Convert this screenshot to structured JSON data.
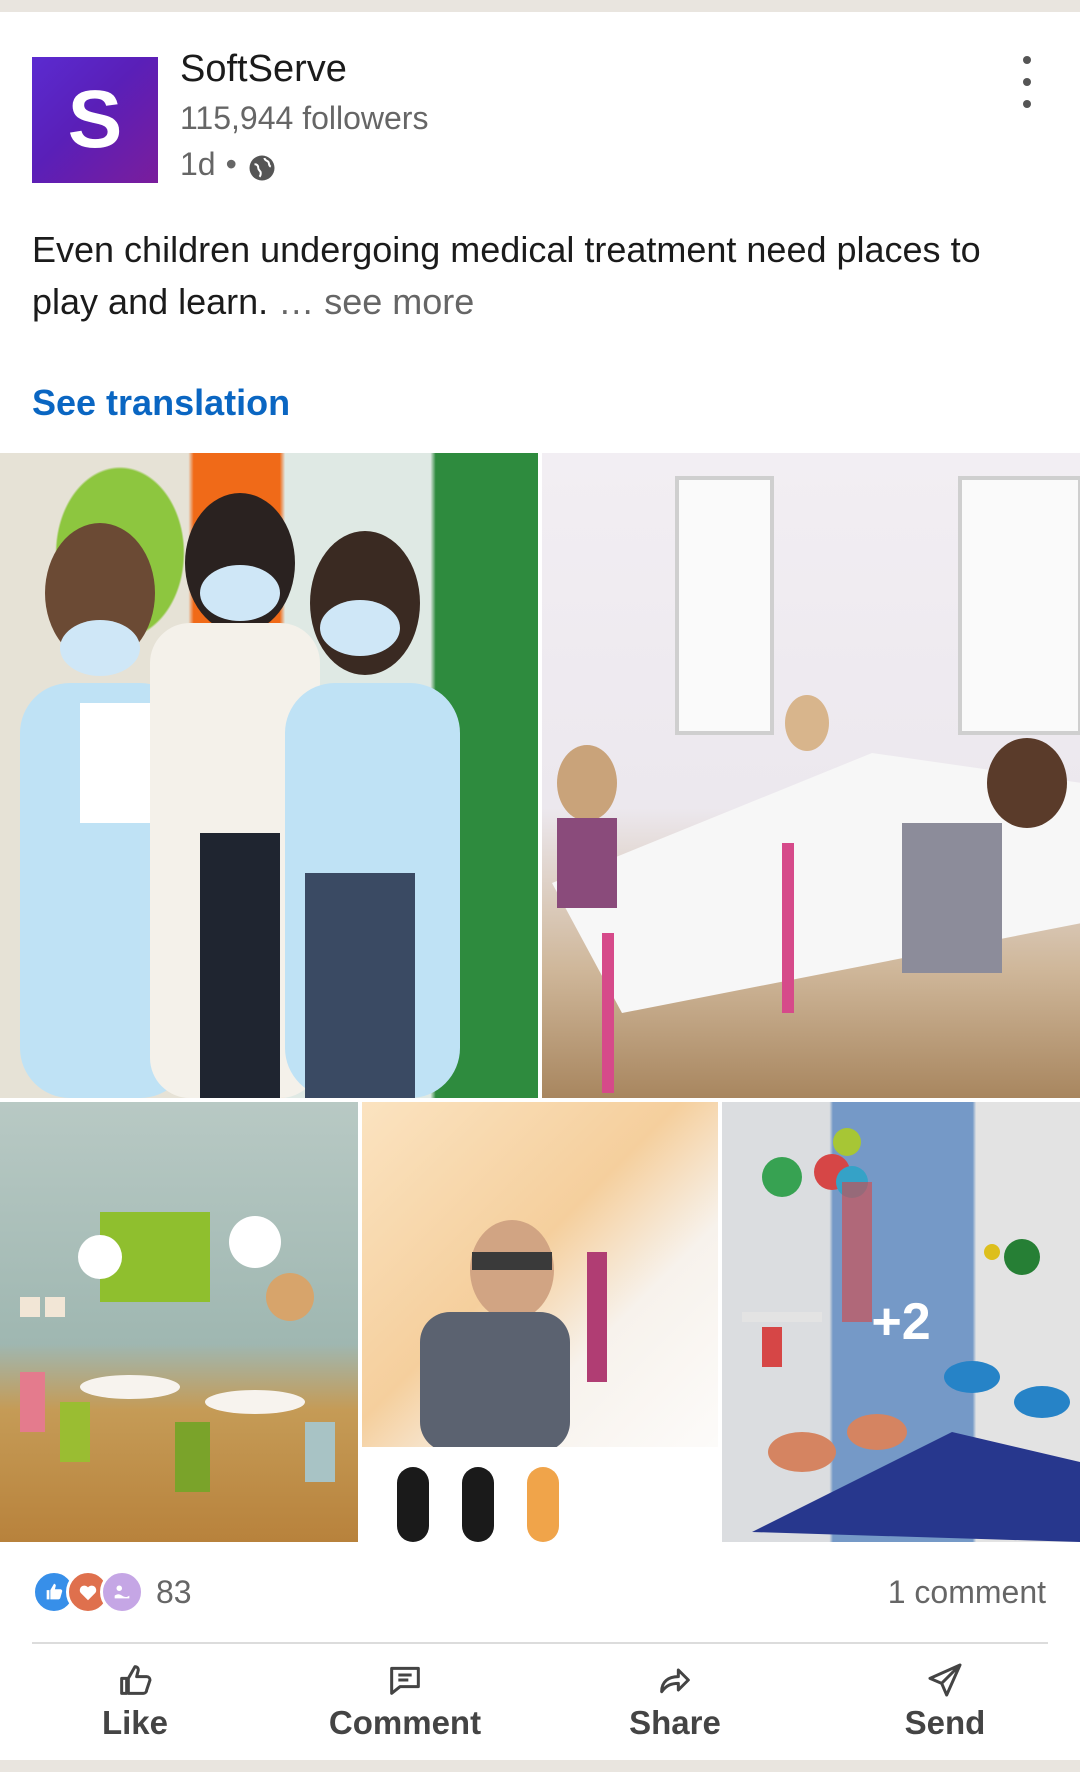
{
  "post": {
    "company": "SoftServe",
    "logo_letter": "S",
    "followers": "115,944 followers",
    "time": "1d",
    "separator": "•",
    "text": "Even children undergoing medical treatment need places to play and learn.",
    "see_more": "… see more",
    "see_translation": "See translation"
  },
  "media": {
    "extra_count": "+2"
  },
  "social": {
    "reactions_count": "83",
    "reaction_icons": [
      "like-icon",
      "love-icon",
      "support-icon"
    ],
    "comments": "1 comment"
  },
  "actions": {
    "like": "Like",
    "comment": "Comment",
    "share": "Share",
    "send": "Send"
  },
  "colors": {
    "link_blue": "#0a66c2",
    "logo_purple": "#5b2bd0",
    "like_blue": "#378fe9",
    "love_orange": "#df704d",
    "support_purple": "#c5a6e5"
  }
}
